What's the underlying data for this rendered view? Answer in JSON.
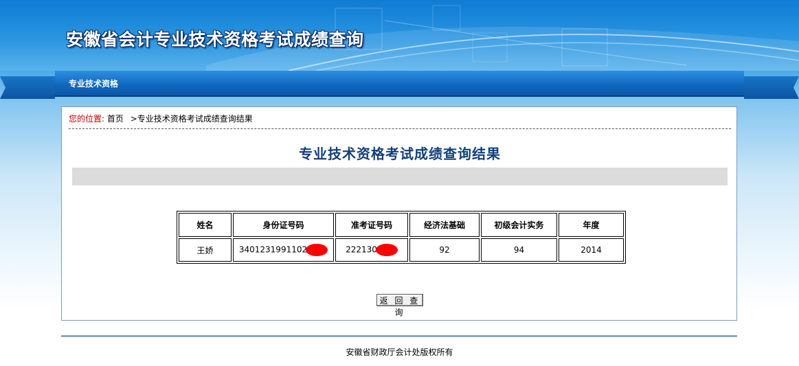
{
  "header": {
    "title": "安徽省会计专业技术资格考试成绩查询"
  },
  "nav": {
    "tab_label": "专业技术资格"
  },
  "breadcrumb": {
    "label": "您的位置:",
    "home": "首页",
    "current": ">专业技术资格考试成绩查询结果"
  },
  "result": {
    "title": "专业技术资格考试成绩查询结果",
    "columns": [
      "姓名",
      "身份证号码",
      "准考证号码",
      "经济法基础",
      "初级会计实务",
      "年度"
    ],
    "rows": [
      {
        "name": "王娇",
        "id_number": "3401231991102",
        "exam_number": "222130",
        "economic_law": "92",
        "accounting_practice": "94",
        "year": "2014"
      }
    ],
    "redaction_color": "#ff0000"
  },
  "actions": {
    "back_label": "返 回 查 询"
  },
  "footer": {
    "copyright": "安徽省财政厅会计处版权所有"
  },
  "colors": {
    "banner_blue": "#1f8ad6",
    "title_navy": "#13407a",
    "breadcrumb_red": "#c00000"
  }
}
